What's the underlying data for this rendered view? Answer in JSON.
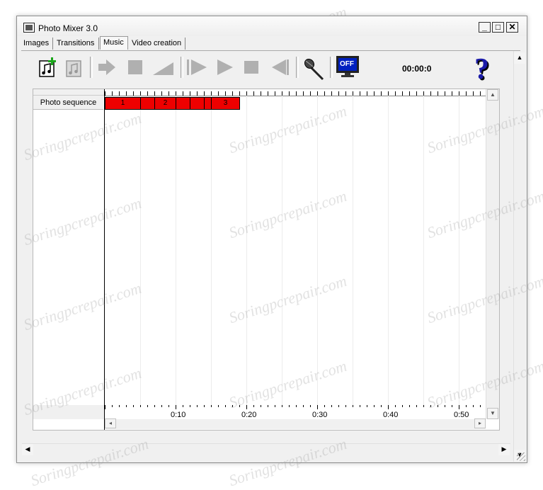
{
  "window": {
    "title": "Photo Mixer 3.0"
  },
  "caption_buttons": {
    "minimize": "_",
    "maximize": "□",
    "close": "✕"
  },
  "tabs": [
    {
      "label": "Images"
    },
    {
      "label": "Transitions"
    },
    {
      "label": "Music",
      "active": true
    },
    {
      "label": "Video creation"
    }
  ],
  "toolbar": {
    "buttons": [
      {
        "icon": "add-music-icon",
        "enabled": true
      },
      {
        "icon": "music-note-icon",
        "enabled": false
      },
      {
        "icon": "arrow-right-icon",
        "enabled": false
      },
      {
        "icon": "stop-square-icon",
        "enabled": false
      },
      {
        "icon": "fade-ramp-icon",
        "enabled": false
      },
      {
        "icon": "step-forward-icon",
        "enabled": false
      },
      {
        "icon": "play-icon",
        "enabled": false
      },
      {
        "icon": "stop-icon",
        "enabled": false
      },
      {
        "icon": "rewind-icon",
        "enabled": false
      },
      {
        "icon": "microphone-icon",
        "enabled": true
      },
      {
        "icon": "preview-off-icon",
        "enabled": true,
        "label": "OFF"
      },
      {
        "icon": "help-icon",
        "enabled": true,
        "label": "?"
      }
    ],
    "time": "00:00:0"
  },
  "timeline": {
    "track_label": "Photo sequence",
    "clips": [
      {
        "label": "1"
      },
      {
        "label": ""
      },
      {
        "label": "2"
      },
      {
        "label": ""
      },
      {
        "label": ""
      },
      {
        "label": ""
      },
      {
        "label": "3"
      }
    ],
    "time_labels": [
      "0:10",
      "0:20",
      "0:30",
      "0:40",
      "0:50"
    ]
  },
  "watermark": "Soringpcrepair.com",
  "colors": {
    "clip": "#ee0000",
    "preview_screen": "#0020c0",
    "help": "#1a1aa8"
  }
}
